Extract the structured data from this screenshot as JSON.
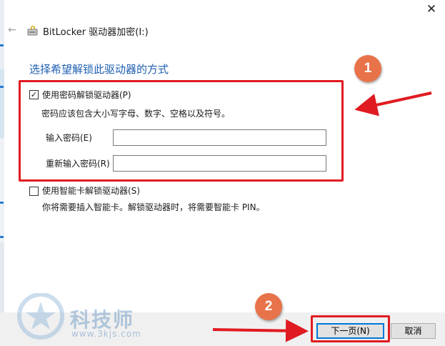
{
  "window": {
    "title": "BitLocker 驱动器加密(I:)",
    "close_glyph": "✕",
    "back_glyph": "←"
  },
  "main": {
    "heading": "选择希望解锁此驱动器的方式",
    "password_option": {
      "label": "使用密码解锁驱动器(P)",
      "checked": true,
      "hint": "密码应该包含大小写字母、数字、空格以及符号。",
      "enter_label": "输入密码(E)",
      "enter_value": "",
      "reenter_label": "重新输入密码(R)",
      "reenter_value": ""
    },
    "smartcard_option": {
      "label": "使用智能卡解锁驱动器(S)",
      "checked": false,
      "hint": "你将需要插入智能卡。解锁驱动器时，将需要智能卡 PIN。"
    }
  },
  "footer": {
    "next_label": "下一页(N)",
    "cancel_label": "取消"
  },
  "annotations": {
    "badge_1": "1",
    "badge_2": "2",
    "highlight_color": "#e01b22",
    "badge_color": "#e8734a"
  },
  "watermark": {
    "title": "科技师",
    "url": "www.3kjs.com"
  },
  "colors": {
    "heading": "#1f5fb0",
    "primary_border": "#0078d7",
    "footer_bg": "#f0f0f0"
  }
}
